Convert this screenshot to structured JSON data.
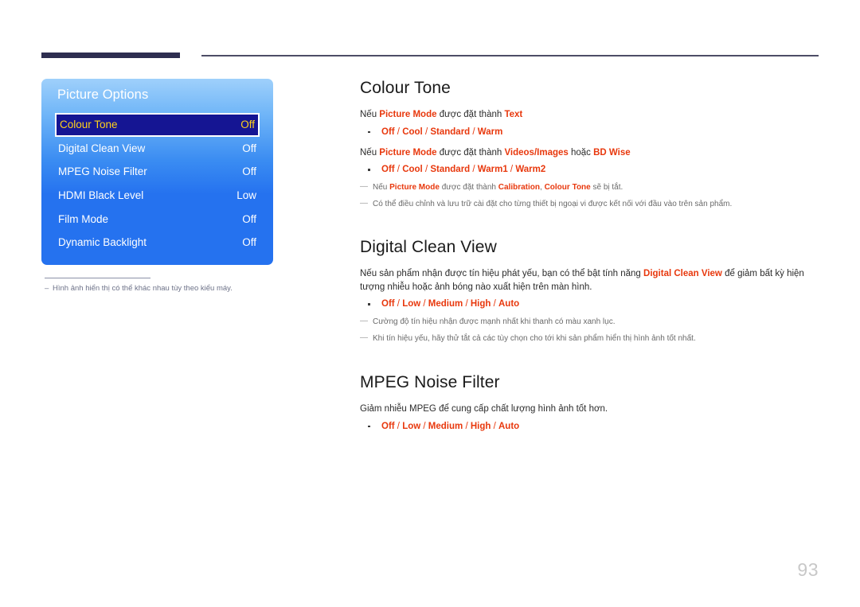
{
  "page": {
    "number": "93"
  },
  "osd": {
    "title": "Picture Options",
    "rows": [
      {
        "label": "Colour Tone",
        "value": "Off",
        "selected": true
      },
      {
        "label": "Digital Clean View",
        "value": "Off",
        "selected": false
      },
      {
        "label": "MPEG Noise Filter",
        "value": "Off",
        "selected": false
      },
      {
        "label": "HDMI Black Level",
        "value": "Low",
        "selected": false
      },
      {
        "label": "Film Mode",
        "value": "Off",
        "selected": false
      },
      {
        "label": "Dynamic Backlight",
        "value": "Off",
        "selected": false
      }
    ],
    "footnote": "Hình ảnh hiển thị có thể khác nhau tùy theo kiểu máy."
  },
  "sections": {
    "colour_tone": {
      "title": "Colour Tone",
      "line1_a": "Nếu ",
      "line1_b": "Picture Mode",
      "line1_c": " được đặt thành ",
      "line1_d": "Text",
      "options1": [
        "Off",
        "Cool",
        "Standard",
        "Warm"
      ],
      "line2_a": "Nếu ",
      "line2_b": "Picture Mode",
      "line2_c": " được đặt thành ",
      "line2_d": "Videos/Images",
      "line2_e": " hoặc ",
      "line2_f": "BD Wise",
      "options2": [
        "Off",
        "Cool",
        "Standard",
        "Warm1",
        "Warm2"
      ],
      "note1_a": "Nếu ",
      "note1_b": "Picture Mode",
      "note1_c": " được đặt thành ",
      "note1_d": "Calibration",
      "note1_e": ", ",
      "note1_f": "Colour Tone",
      "note1_g": " sẽ bị tắt.",
      "note2": "Có thể điều chỉnh và lưu trữ cài đặt cho từng thiết bị ngoại vi được kết nối với đầu vào trên sản phẩm."
    },
    "digital_clean_view": {
      "title": "Digital Clean View",
      "para_a": "Nếu sản phẩm nhận được tín hiệu phát yếu, bạn có thể bật tính năng ",
      "para_b": "Digital Clean View",
      "para_c": " để giảm bất kỳ hiện tượng nhiễu hoặc ảnh bóng nào xuất hiện trên màn hình.",
      "options": [
        "Off",
        "Low",
        "Medium",
        "High",
        "Auto"
      ],
      "note1": "Cường độ tín hiệu nhận được mạnh nhất khi thanh có màu xanh lục.",
      "note2": "Khi tín hiệu yếu, hãy thử tắt cả các tùy chọn cho tới khi sản phẩm hiển thị hình ảnh tốt nhất."
    },
    "mpeg_noise_filter": {
      "title": "MPEG Noise Filter",
      "para": "Giảm nhiễu MPEG để cung cấp chất lượng hình ảnh tốt hơn.",
      "options": [
        "Off",
        "Low",
        "Medium",
        "High",
        "Auto"
      ]
    }
  },
  "colors": {
    "accent_red": "#e8380d",
    "osd_blue": "#2572ef",
    "osd_selected_bg": "#151593",
    "osd_selected_text": "#ffd11a",
    "rule_navy": "#2e2e50"
  }
}
